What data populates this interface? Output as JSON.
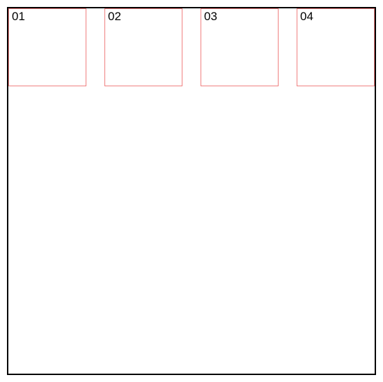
{
  "boxes": {
    "b1": {
      "label": "01"
    },
    "b2": {
      "label": "02"
    },
    "b3": {
      "label": "03"
    },
    "b4": {
      "label": "04"
    }
  }
}
